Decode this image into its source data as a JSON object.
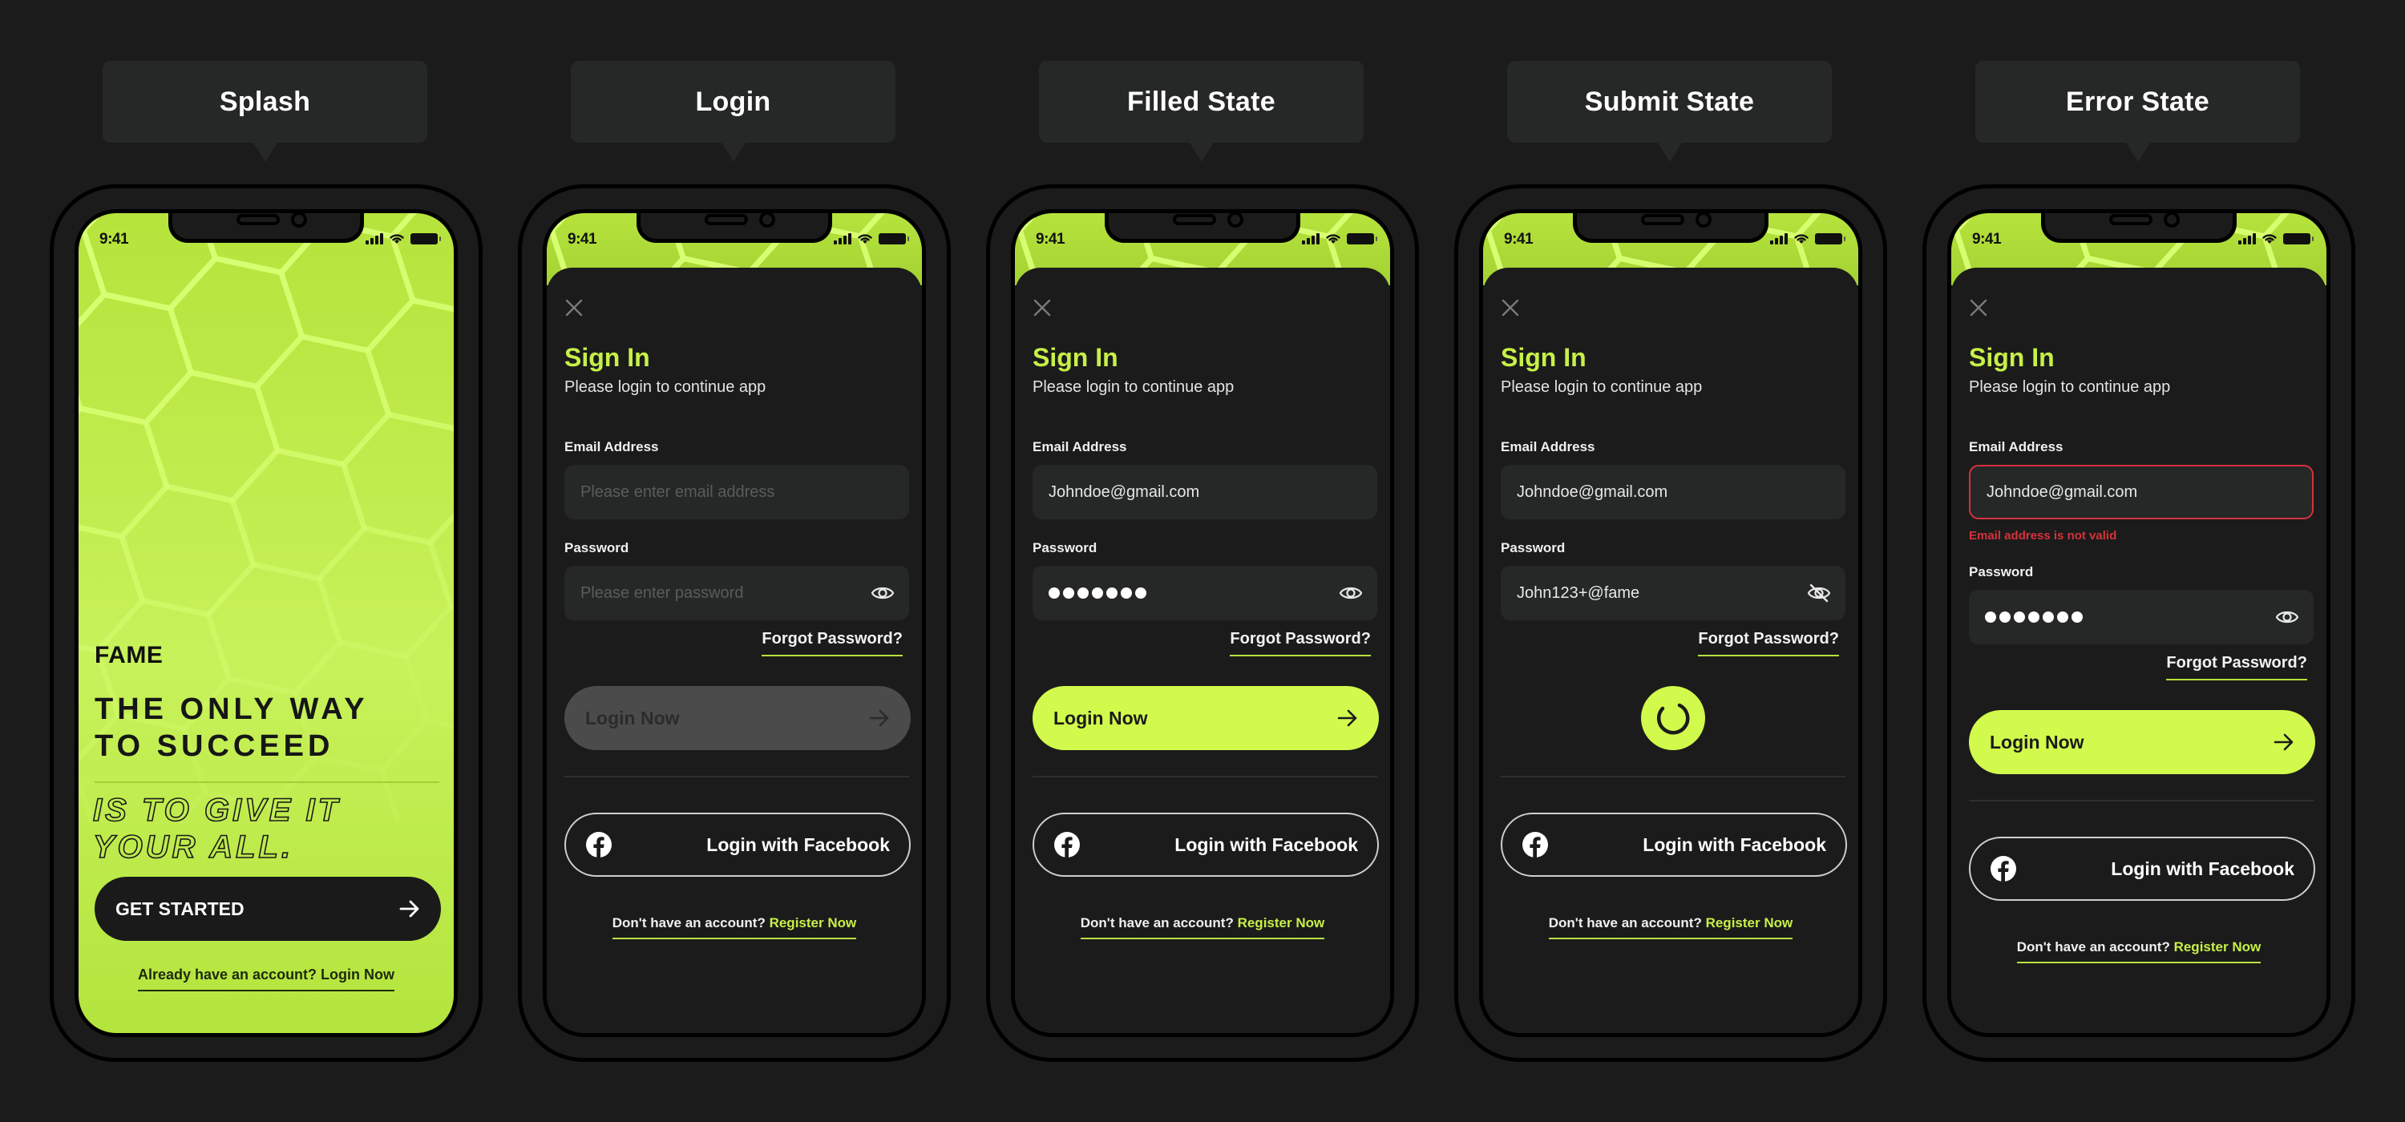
{
  "colors": {
    "background": "#1b1b1b",
    "accent": "#d2fa4c",
    "accent_text": "#c6f048",
    "error": "#d6323a",
    "field_bg": "#262828"
  },
  "status_bar": {
    "time": "9:41"
  },
  "screens": [
    {
      "label": "Splash",
      "brand": "FAME",
      "headline_line1": "THE ONLY WAY",
      "headline_line2": "TO SUCCEED",
      "tagline_line1": "IS TO GIVE IT",
      "tagline_line2": "YOUR ALL.",
      "cta_label": "GET STARTED",
      "login_prompt": "Already have an account? Login Now"
    },
    {
      "label": "Login",
      "title": "Sign In",
      "subtitle": "Please login to continue app",
      "email_label": "Email Address",
      "email_placeholder": "Please enter email address",
      "email_value": "",
      "password_label": "Password",
      "password_placeholder": "Please enter password",
      "password_value": "",
      "password_icon": "eye-icon",
      "forgot": "Forgot Password?",
      "login_button": "Login Now",
      "login_state": "disabled",
      "facebook_button": "Login with Facebook",
      "register_prompt": "Don't have an account?",
      "register_link": "Register Now"
    },
    {
      "label": "Filled State",
      "title": "Sign In",
      "subtitle": "Please login to continue app",
      "email_label": "Email Address",
      "email_value": "Johndoe@gmail.com",
      "password_label": "Password",
      "password_masked_length": 7,
      "password_icon": "eye-icon",
      "forgot": "Forgot Password?",
      "login_button": "Login Now",
      "login_state": "active",
      "facebook_button": "Login with Facebook",
      "register_prompt": "Don't have an account?",
      "register_link": "Register Now"
    },
    {
      "label": "Submit State",
      "title": "Sign In",
      "subtitle": "Please login to continue app",
      "email_label": "Email Address",
      "email_value": "Johndoe@gmail.com",
      "password_label": "Password",
      "password_value": "John123+@fame",
      "password_icon": "eye-off-icon",
      "forgot": "Forgot Password?",
      "login_state": "loading",
      "facebook_button": "Login with Facebook",
      "register_prompt": "Don't have an account?",
      "register_link": "Register Now"
    },
    {
      "label": "Error State",
      "title": "Sign In",
      "subtitle": "Please login to continue app",
      "email_label": "Email Address",
      "email_value": "Johndoe@gmail.com",
      "email_error": "Email address is not valid",
      "password_label": "Password",
      "password_masked_length": 7,
      "password_icon": "eye-icon",
      "forgot": "Forgot Password?",
      "login_button": "Login Now",
      "login_state": "active",
      "facebook_button": "Login with Facebook",
      "register_prompt": "Don't have an account?",
      "register_link": "Register Now"
    }
  ]
}
